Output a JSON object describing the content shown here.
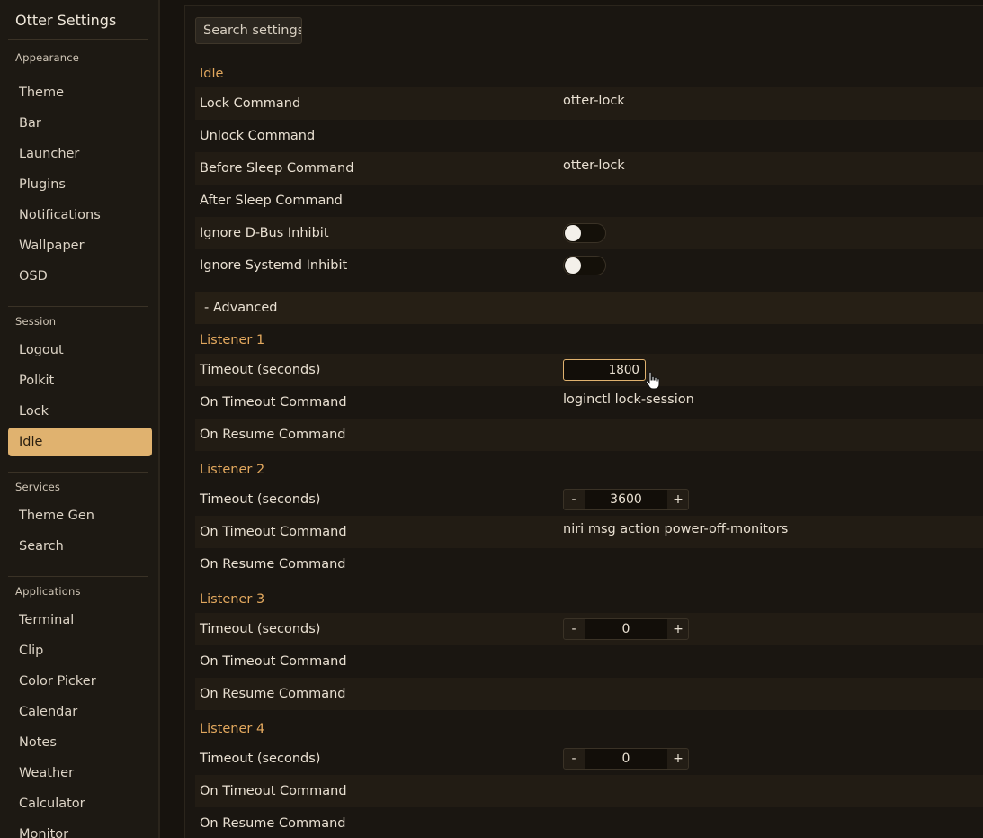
{
  "app": {
    "title": "Otter Settings"
  },
  "sidebar": {
    "groups": [
      {
        "label": "Appearance",
        "items": [
          "Theme",
          "Bar",
          "Launcher",
          "Plugins",
          "Notifications",
          "Wallpaper",
          "OSD"
        ]
      },
      {
        "label": "Session",
        "items": [
          "Logout",
          "Polkit",
          "Lock",
          "Idle"
        ]
      },
      {
        "label": "Services",
        "items": [
          "Theme Gen",
          "Search"
        ]
      },
      {
        "label": "Applications",
        "items": [
          "Terminal",
          "Clip",
          "Color Picker",
          "Calendar",
          "Notes",
          "Weather",
          "Calculator",
          "Monitor"
        ]
      }
    ],
    "active": "Idle"
  },
  "main": {
    "search_placeholder": "Search settings",
    "idle_title": "Idle",
    "idle_rows": [
      {
        "label": "Lock Command",
        "value": "otter-lock"
      },
      {
        "label": "Unlock Command",
        "value": ""
      },
      {
        "label": "Before Sleep Command",
        "value": "otter-lock"
      },
      {
        "label": "After Sleep Command",
        "value": ""
      }
    ],
    "toggles": [
      {
        "label": "Ignore D-Bus Inhibit",
        "on": false
      },
      {
        "label": "Ignore Systemd Inhibit",
        "on": false
      }
    ],
    "advanced_label": "- Advanced",
    "listeners": [
      {
        "title": "Listener 1",
        "timeout_label": "Timeout (seconds)",
        "timeout": "1800",
        "on_timeout_label": "On Timeout Command",
        "on_timeout": "loginctl lock-session",
        "on_resume_label": "On Resume Command",
        "on_resume": ""
      },
      {
        "title": "Listener 2",
        "timeout_label": "Timeout (seconds)",
        "timeout": "3600",
        "on_timeout_label": "On Timeout Command",
        "on_timeout": "niri msg action power-off-monitors",
        "on_resume_label": "On Resume Command",
        "on_resume": ""
      },
      {
        "title": "Listener 3",
        "timeout_label": "Timeout (seconds)",
        "timeout": "0",
        "on_timeout_label": "On Timeout Command",
        "on_timeout": "",
        "on_resume_label": "On Resume Command",
        "on_resume": ""
      },
      {
        "title": "Listener 4",
        "timeout_label": "Timeout (seconds)",
        "timeout": "0",
        "on_timeout_label": "On Timeout Command",
        "on_timeout": "",
        "on_resume_label": "On Resume Command",
        "on_resume": ""
      }
    ],
    "stepper_minus": "-",
    "stepper_plus": "+"
  },
  "colors": {
    "accent": "#e0b26f",
    "section": "#e2a85e",
    "bg": "#17130e"
  }
}
